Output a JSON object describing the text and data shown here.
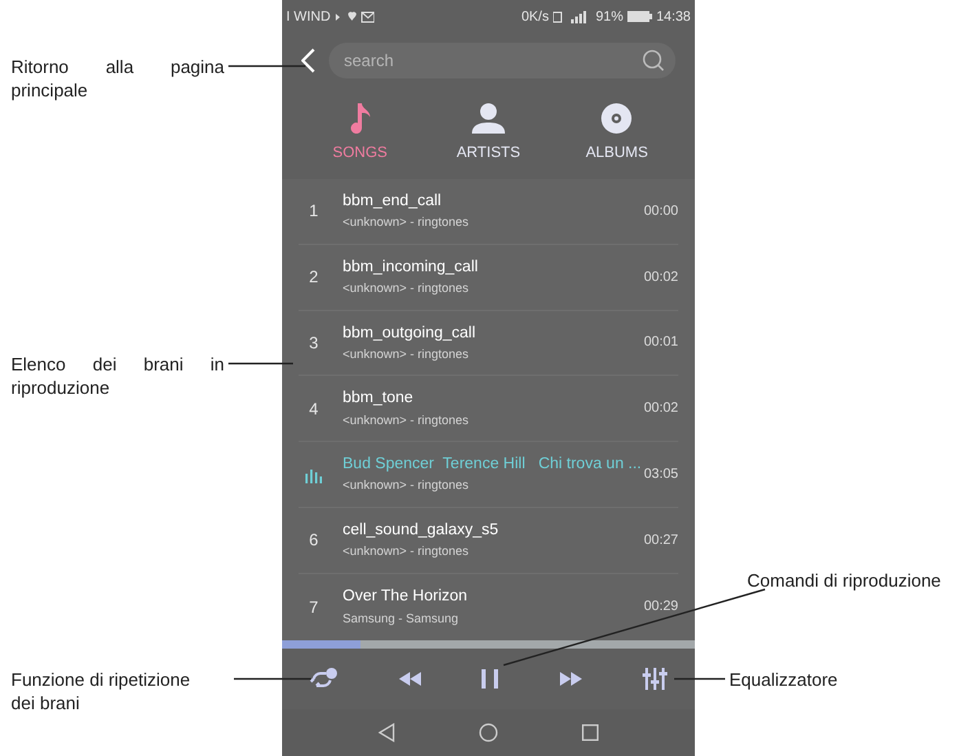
{
  "status_bar": {
    "carrier": "I WIND",
    "speed": "0K/s",
    "battery": "91%",
    "time": "14:38"
  },
  "search": {
    "placeholder": "search"
  },
  "tabs": [
    {
      "label": "SONGS",
      "kind": "note",
      "selected": true
    },
    {
      "label": "ARTISTS",
      "kind": "person",
      "selected": false
    },
    {
      "label": "ALBUMS",
      "kind": "disc",
      "selected": false
    }
  ],
  "songs": [
    {
      "number": "1",
      "title": "bbm_end_call",
      "subtitle": "<unknown> - ringtones",
      "duration": "00:00",
      "playing": false
    },
    {
      "number": "2",
      "title": "bbm_incoming_call",
      "subtitle": "<unknown> - ringtones",
      "duration": "00:02",
      "playing": false
    },
    {
      "number": "3",
      "title": "bbm_outgoing_call",
      "subtitle": "<unknown> - ringtones",
      "duration": "00:01",
      "playing": false
    },
    {
      "number": "4",
      "title": "bbm_tone",
      "subtitle": "<unknown> - ringtones",
      "duration": "00:02",
      "playing": false
    },
    {
      "title": "Bud Spencer  Terence Hill   Chi trova un ...",
      "subtitle": "<unknown> - ringtones",
      "duration": "03:05",
      "playing": true
    },
    {
      "number": "6",
      "title": "cell_sound_galaxy_s5",
      "subtitle": "<unknown> - ringtones",
      "duration": "00:27",
      "playing": false
    },
    {
      "number": "7",
      "title": "Over The Horizon",
      "subtitle": "Samsung - Samsung",
      "duration": "00:29",
      "playing": false
    }
  ],
  "progress": {
    "level": 0.19
  },
  "annotations": [
    {
      "text": "Ritorno alla pagina principale"
    },
    {
      "text": "Elenco dei brani in riproduzione"
    },
    {
      "text": "Funzione di ripetizione dei brani"
    },
    {
      "text": "Comandi di riproduzione"
    },
    {
      "text": "Equalizzatore"
    }
  ]
}
